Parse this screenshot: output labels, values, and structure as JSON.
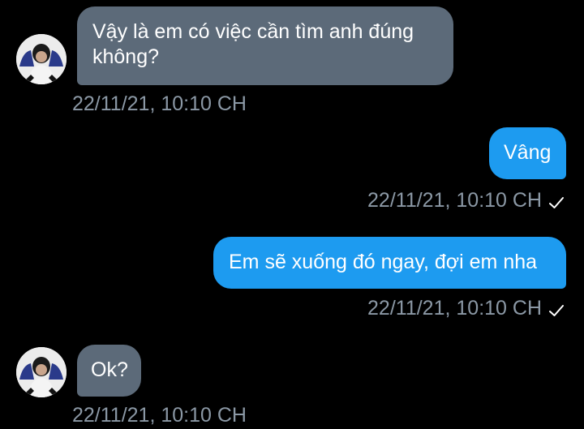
{
  "messages": [
    {
      "direction": "incoming",
      "text_line1": "Vậy là em có việc cần tìm anh đúng",
      "text_line2": "không?",
      "time": "22/11/21, 10:10 CH",
      "avatar": "user-avatar"
    },
    {
      "direction": "outgoing",
      "text": "Vâng",
      "time": "22/11/21, 10:10 CH",
      "status_icon": "checkmark-icon"
    },
    {
      "direction": "outgoing",
      "text": "Em sẽ xuống đó ngay, đợi em nha",
      "time": "22/11/21, 10:10 CH",
      "status_icon": "checkmark-icon"
    },
    {
      "direction": "incoming",
      "text": "Ok?",
      "time": "22/11/21, 10:10 CH",
      "avatar": "user-avatar"
    }
  ],
  "colors": {
    "background": "#000000",
    "incoming_bubble": "#5c6a79",
    "outgoing_bubble": "#1d9bf0",
    "timestamp": "#8b98a5",
    "text": "#ffffff"
  }
}
